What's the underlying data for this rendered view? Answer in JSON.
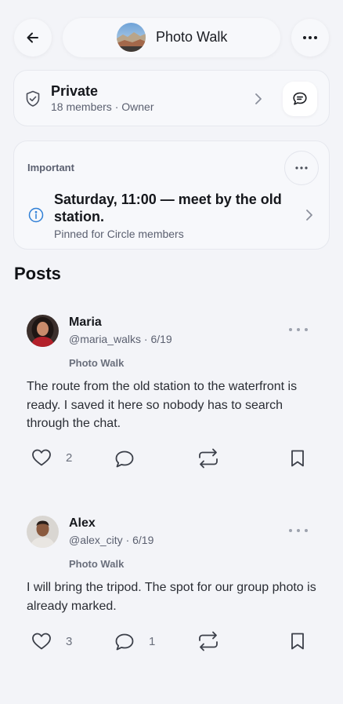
{
  "header": {
    "title": "Photo Walk",
    "back_icon": "arrow-left-icon",
    "more_icon": "more-horizontal-icon"
  },
  "group_card": {
    "privacy": "Private",
    "subtitle": "18 members · Owner",
    "icon": "shield-check-icon",
    "chat_icon": "chat-bubble-icon"
  },
  "pinned": {
    "label": "Important",
    "title": "Saturday, 11:00 — meet by the old station.",
    "subtitle": "Pinned for Circle members",
    "icon": "info-icon"
  },
  "posts_heading": "Posts",
  "posts": [
    {
      "author": "Maria",
      "meta": "@maria_walks · 6/19",
      "tag": "Photo Walk",
      "body": "The route from the old station to the waterfront is ready. I saved it here so nobody has to search through the chat.",
      "likes": "2",
      "comments": ""
    },
    {
      "author": "Alex",
      "meta": "@alex_city · 6/19",
      "tag": "Photo Walk",
      "body": "I will bring the tripod. The spot for our group photo is already marked.",
      "likes": "3",
      "comments": "1"
    }
  ],
  "colors": {
    "background": "#f3f4f8",
    "card": "#f7f8fb",
    "text": "#15171c",
    "muted": "#5b6070",
    "info_blue": "#2f7fd6"
  }
}
